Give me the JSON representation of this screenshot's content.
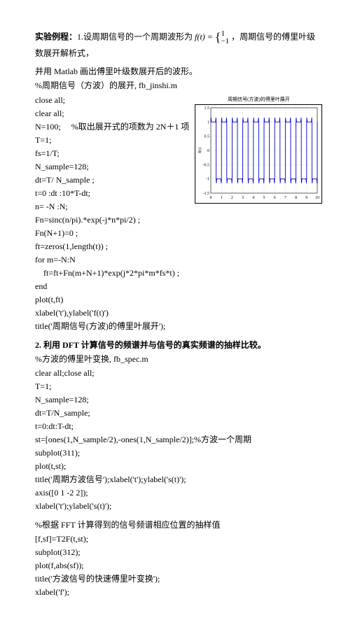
{
  "heading": {
    "label": "实验例程：",
    "part1": "1.设周期信号的一个周期波形为",
    "formula": "f(t) = ",
    "brace_top": "1",
    "brace_bot": "−1",
    "part2": "，周期信号的傅里叶级数展开解析式，"
  },
  "intro_line": "并用 Matlab 画出傅里叶级数展开后的波形。",
  "section1_comment": "%周期信号（方波）的展开,  fb_jinshi.m",
  "code1": [
    "close all;",
    "clear all;",
    "N=100;     %取出展开式的项数为 2N＋1 项",
    "T=1;",
    "fs=1/T;",
    "N_sample=128;",
    "dt=T/ N_sample ;",
    "t=0 :dt :10*T-dt;",
    "n= -N :N;",
    "Fn=sinc(n/pi).*exp(-j*n*pi/2) ;",
    "Fn(N+1)=0 ;",
    "ft=zeros(1,length(t)) ;",
    "for m=-N:N",
    "    ft=ft+Fn(m+N+1)*exp(j*2*pi*m*fs*t) ;",
    "end",
    "plot(t,ft)",
    "xlabel('t'),ylabel('f(t)')",
    "title('周期信号(方波)的傅里叶展开');"
  ],
  "section2_heading": "2.  利用 DFT 计算信号的频谱并与信号的真实频谱的抽样比较。",
  "section2_comment": "%方波的傅里叶变换,  fb_spec.m",
  "code2": [
    "clear all;close all;",
    "T=1;",
    "N_sample=128;",
    "dt=T/N_sample;",
    "t=0:dt:T-dt;",
    "st=[ones(1,N_sample/2),-ones(1,N_sample/2)];%方波一个周期",
    "subplot(311);",
    "plot(t,st);",
    "title('周期方波信号');xlabel('t');ylabel('s(t)');",
    "axis([0 1 -2 2]);",
    "xlabel('t');ylabel('s(t)');"
  ],
  "section3_comment": "%根据 FFT 计算得到的信号频谱相应位置的抽样值",
  "code3": [
    "[f,sf]=T2F(t,st);",
    "subplot(312);",
    "plot(f,abs(sf));",
    "title('方波信号的快速傅里叶变换');",
    "xlabel('f');"
  ],
  "chart_data": {
    "type": "line",
    "title": "周期信号(方波)的傅里叶展开",
    "xlabel": "",
    "ylabel": "f(t)",
    "xlim": [
      0,
      10
    ],
    "ylim": [
      -1.5,
      1.5
    ],
    "xticks": [
      0,
      1,
      2,
      3,
      4,
      5,
      6,
      7,
      8,
      9,
      10
    ],
    "yticks": [
      -1.5,
      -1,
      -0.5,
      0,
      0.5,
      1,
      1.5
    ],
    "period": 1,
    "duty": 0.5,
    "high": 1,
    "low": -1,
    "overshoot_high": 1.15,
    "overshoot_low": -1.15,
    "description": "Square wave, 10 periods over t=0..10, amplitude ±1 with Gibbs overshoot spikes to ~±1.15 at each transition"
  }
}
